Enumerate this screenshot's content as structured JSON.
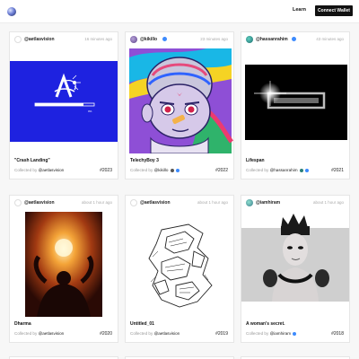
{
  "header": {
    "learn_label": "Learn",
    "connect_label": "Connect Wallet"
  },
  "cards": [
    {
      "handle": "@aetlasvision",
      "time": "16 minutes ago",
      "title": "\"Crash Landing\"",
      "collected_prefix": "Collected by",
      "collector": "@aetlasvision",
      "number": "#2023",
      "progress_label": "0%"
    },
    {
      "handle": "@kikillo",
      "time": "23 minutes ago",
      "title": "TelechyBoy 3",
      "collected_prefix": "Collected by",
      "collector": "@kikillo",
      "number": "#2022"
    },
    {
      "handle": "@hassanrahim",
      "time": "43 minutes ago",
      "title": "Lifespan",
      "collected_prefix": "Collected by",
      "collector": "@hassanrahim",
      "number": "#2021"
    },
    {
      "handle": "@aetlasvision",
      "time": "about 1 hour ago",
      "title": "Dharma",
      "collected_prefix": "Collected by",
      "collector": "@aetlasvision",
      "number": "#2020"
    },
    {
      "handle": "@aetlasvision",
      "time": "about 1 hour ago",
      "title": "Untitled_01",
      "collected_prefix": "Collected by",
      "collector": "@aetlasvision",
      "number": "#2019"
    },
    {
      "handle": "@iamhiram",
      "time": "about 1 hour ago",
      "title": "A woman's secret.",
      "collected_prefix": "Collected by",
      "collector": "@iamhiram",
      "number": "#2018"
    }
  ]
}
